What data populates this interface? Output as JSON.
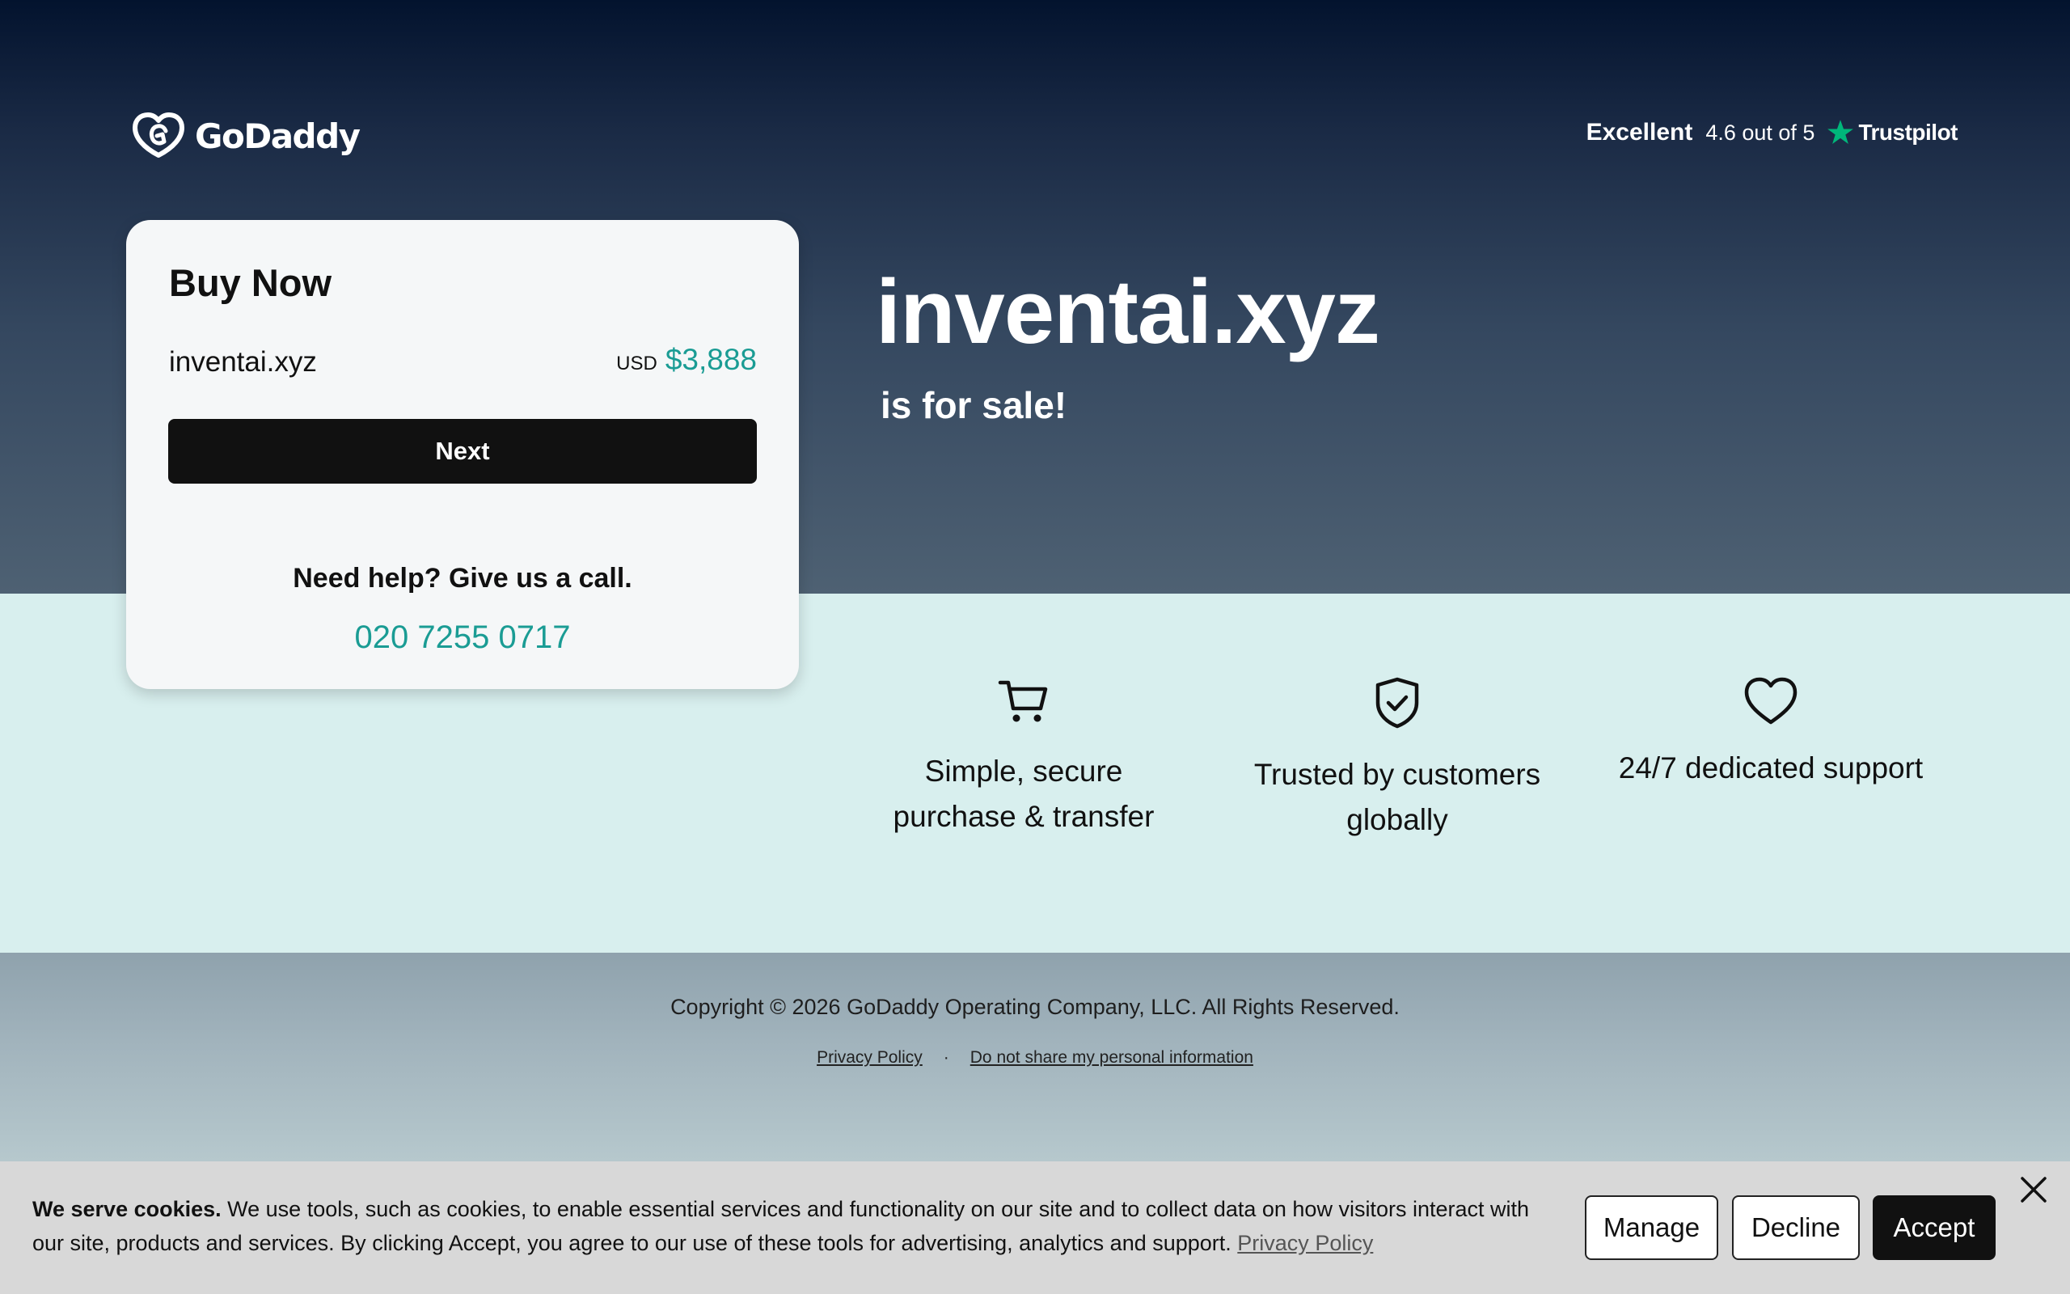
{
  "brand": {
    "name": "GoDaddy"
  },
  "trustpilot": {
    "rating_label": "Excellent",
    "score": "4.6 out of 5",
    "brand": "Trustpilot",
    "star_color": "#00b67a"
  },
  "buy_card": {
    "title": "Buy Now",
    "domain": "inventai.xyz",
    "currency": "USD",
    "price": "$3,888",
    "next_label": "Next",
    "help_text": "Need help? Give us a call.",
    "phone": "020 7255 0717"
  },
  "hero": {
    "domain": "inventai.xyz",
    "subtitle": "is for sale!"
  },
  "features": [
    {
      "icon": "cart-icon",
      "line1": "Simple, secure",
      "line2": "purchase & transfer"
    },
    {
      "icon": "shield-check-icon",
      "line1": "Trusted by customers",
      "line2": "globally"
    },
    {
      "icon": "heart-icon",
      "line1": "24/7 dedicated support",
      "line2": ""
    }
  ],
  "footer": {
    "copyright": "Copyright © 2026 GoDaddy Operating Company, LLC. All Rights Reserved.",
    "privacy_label": "Privacy Policy",
    "separator": "·",
    "do_not_share_label": "Do not share my personal information"
  },
  "cookie": {
    "heading": "We serve cookies.",
    "body": " We use tools, such as cookies, to enable essential services and functionality on our site and to collect data on how visitors interact with our site, products and services. By clicking Accept, you agree to our use of these tools for advertising, analytics and support. ",
    "privacy_label": "Privacy Policy",
    "manage_label": "Manage",
    "decline_label": "Decline",
    "accept_label": "Accept"
  },
  "colors": {
    "accent": "#1a9c94",
    "hero_top": "#03132e",
    "hero_bottom": "#4e6173",
    "band": "#d8efee"
  }
}
